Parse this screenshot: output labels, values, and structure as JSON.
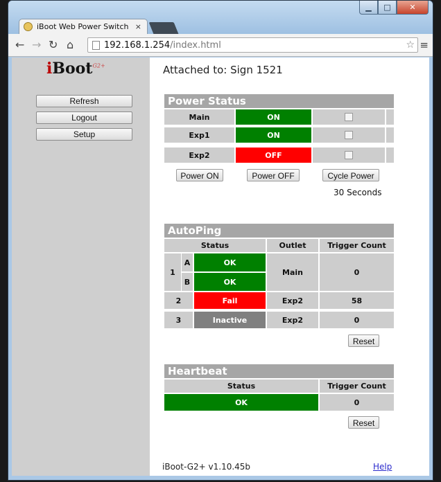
{
  "browser": {
    "tab_title": "iBoot Web Power Switch",
    "tab_close": "×",
    "url_host": "192.168.1.254",
    "url_path": "/index.html"
  },
  "logo": {
    "main": "iBoot",
    "superscript": "G2+"
  },
  "sidebar": {
    "buttons": [
      "Refresh",
      "Logout",
      "Setup"
    ]
  },
  "attached_to": "Attached to: Sign 1521",
  "power_status": {
    "title": "Power Status",
    "outlets": [
      {
        "name": "Main",
        "state": "ON"
      },
      {
        "name": "Exp1",
        "state": "ON"
      },
      {
        "name": "Exp2",
        "state": "OFF"
      }
    ],
    "buttons": {
      "power_on": "Power ON",
      "power_off": "Power OFF",
      "cycle": "Cycle Power"
    },
    "cycle_duration": "30 Seconds"
  },
  "autoping": {
    "title": "AutoPing",
    "headers": {
      "status": "Status",
      "outlet": "Outlet",
      "trigger_count": "Trigger Count"
    },
    "rows": [
      {
        "num": "1",
        "sub": [
          "A",
          "B"
        ],
        "status": [
          "OK",
          "OK"
        ],
        "outlet": "Main",
        "count": "0"
      },
      {
        "num": "2",
        "status": "Fail",
        "outlet": "Exp2",
        "count": "58"
      },
      {
        "num": "3",
        "status": "Inactive",
        "outlet": "Exp2",
        "count": "0"
      }
    ],
    "reset": "Reset"
  },
  "heartbeat": {
    "title": "Heartbeat",
    "headers": {
      "status": "Status",
      "trigger_count": "Trigger Count"
    },
    "status": "OK",
    "count": "0",
    "reset": "Reset"
  },
  "footer": {
    "version": "iBoot-G2+ v1.10.45b",
    "help": "Help"
  },
  "colors": {
    "on": "#008000",
    "off": "#ff0000",
    "inactive": "#808080",
    "header": "#a6a6a6"
  }
}
